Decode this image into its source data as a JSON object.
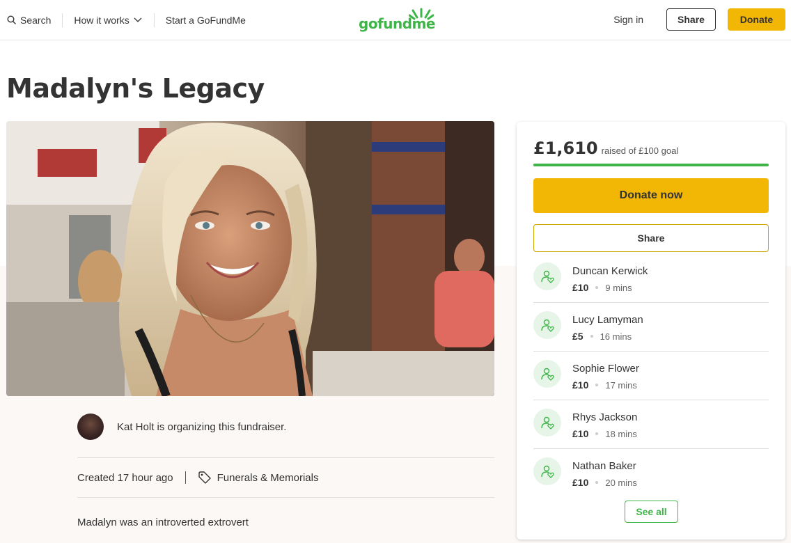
{
  "header": {
    "search_label": "Search",
    "how_it_works_label": "How it works",
    "start_label": "Start a GoFundMe",
    "logo_text": "gofundme",
    "signin_label": "Sign in",
    "share_label": "Share",
    "donate_label": "Donate"
  },
  "campaign": {
    "title": "Madalyn's Legacy",
    "organizer_text": "Kat Holt is organizing this fundraiser.",
    "created_text": "Created 17 hour ago",
    "category": "Funerals & Memorials",
    "story_first_line": "Madalyn was an introverted extrovert"
  },
  "sidebar": {
    "raised_amount": "£1,610",
    "raised_goal_text": "raised of £100 goal",
    "progress_fraction": 1.0,
    "donate_now_label": "Donate now",
    "share_label": "Share",
    "see_all_label": "See all",
    "donations": [
      {
        "name": "Duncan Kerwick",
        "amount": "£10",
        "time": "9 mins"
      },
      {
        "name": "Lucy Lamyman",
        "amount": "£5",
        "time": "16 mins"
      },
      {
        "name": "Sophie Flower",
        "amount": "£10",
        "time": "17 mins"
      },
      {
        "name": "Rhys Jackson",
        "amount": "£10",
        "time": "18 mins"
      },
      {
        "name": "Nathan Baker",
        "amount": "£10",
        "time": "20 mins"
      }
    ]
  },
  "colors": {
    "brand_green": "#3fb549",
    "donate_yellow": "#f2b705",
    "text_dark": "#333333"
  },
  "icons": [
    "search-icon",
    "chevron-down-icon",
    "tag-icon",
    "donor-heart-icon"
  ]
}
